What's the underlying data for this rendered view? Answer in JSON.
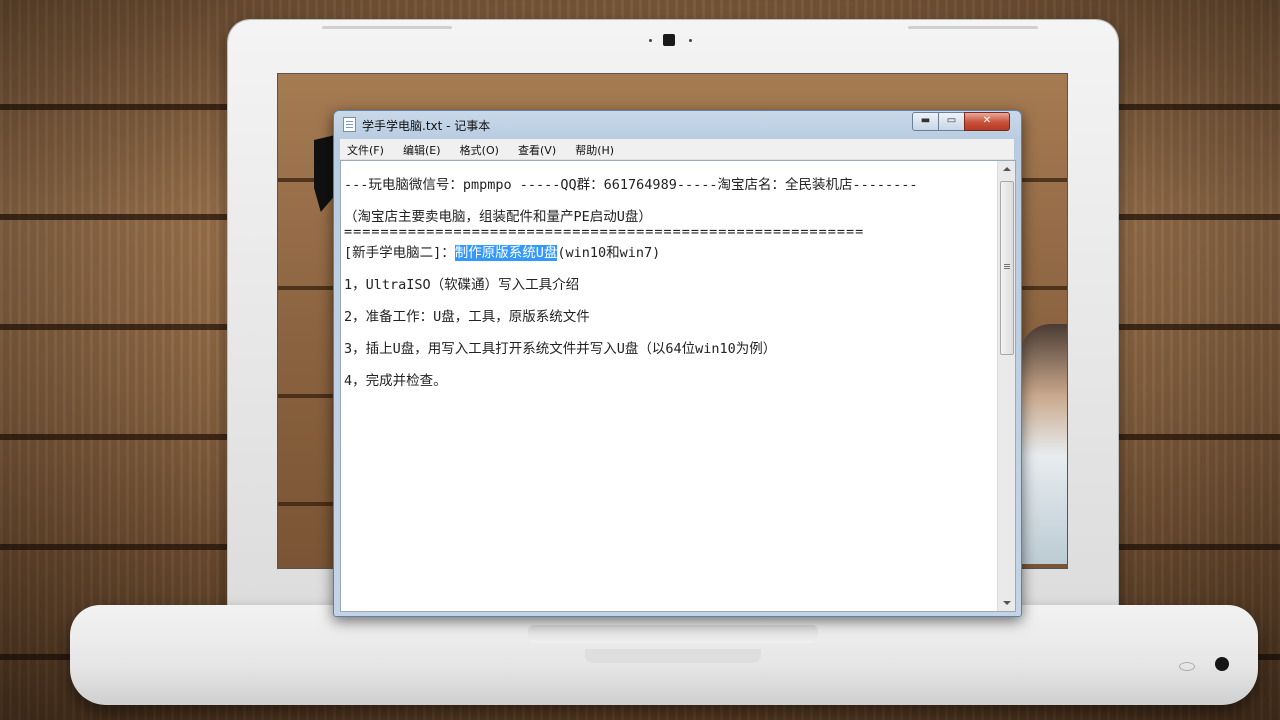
{
  "window": {
    "title": "学手学电脑.txt - 记事本",
    "controls": {
      "minimize": "▬",
      "maximize": "▭",
      "close": "✕"
    }
  },
  "menu": [
    {
      "label": "文件(F)"
    },
    {
      "label": "编辑(E)"
    },
    {
      "label": "格式(O)"
    },
    {
      "label": "查看(V)"
    },
    {
      "label": "帮助(H)"
    }
  ],
  "document": {
    "line1": "---玩电脑微信号：pmpmpo -----QQ群：661764989-----淘宝店名：全民装机店--------",
    "line2": "（淘宝店主要卖电脑，组装配件和量产PE启动U盘）",
    "line3": "=========================================================",
    "line4": {
      "prefix": "[新手学电脑二]：",
      "selected": "制作原版系统U盘",
      "suffix": "(win10和win7)"
    },
    "line5": "1，UltraISO（软碟通）写入工具介绍",
    "line6": "2，准备工作：U盘，工具，原版系统文件",
    "line7": "3，插上U盘，用写入工具打开系统文件并写入U盘（以64位win10为例）",
    "line8": "4，完成并检查。"
  },
  "colors": {
    "selection": "#3399ff",
    "close_button": "#c9503a",
    "titlebar": "#c9d9ea"
  },
  "icons": [
    "notepad-icon",
    "minimize-icon",
    "maximize-icon",
    "close-icon",
    "scroll-up-icon",
    "scroll-down-icon"
  ]
}
